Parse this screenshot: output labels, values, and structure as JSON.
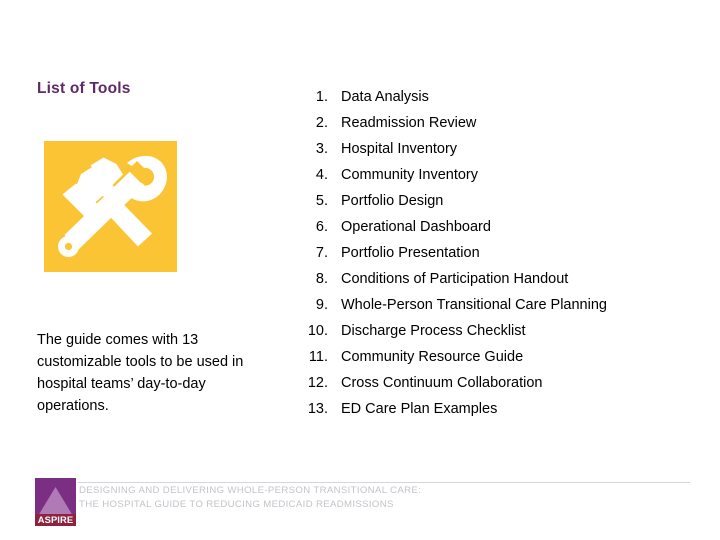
{
  "slide": {
    "title": "List of Tools",
    "background_color": "#ffffff",
    "title_color": "#5e2a68",
    "icon": {
      "name": "hammer-wrench-tools-icon",
      "background_color": "#fbc435",
      "glyph_color": "#ffffff"
    },
    "description": "The guide comes with 13 customizable tools to be used in hospital teams’ day-to-day operations.",
    "tools": [
      {
        "number": "1.",
        "label": "Data Analysis"
      },
      {
        "number": "2.",
        "label": "Readmission Review"
      },
      {
        "number": "3.",
        "label": "Hospital Inventory"
      },
      {
        "number": "4.",
        "label": "Community Inventory"
      },
      {
        "number": "5.",
        "label": "Portfolio Design"
      },
      {
        "number": "6.",
        "label": "Operational Dashboard"
      },
      {
        "number": "7.",
        "label": "Portfolio Presentation"
      },
      {
        "number": "8.",
        "label": "Conditions of Participation Handout"
      },
      {
        "number": "9.",
        "label": "Whole-Person Transitional Care Planning"
      },
      {
        "number": "10.",
        "label": "Discharge Process Checklist"
      },
      {
        "number": "11.",
        "label": "Community Resource Guide"
      },
      {
        "number": "12.",
        "label": "Cross Continuum Collaboration"
      },
      {
        "number": "13.",
        "label": "ED Care Plan Examples"
      }
    ]
  },
  "footer": {
    "logo": {
      "name": "aspire-logo",
      "wordmark": "ASPIRE",
      "square_color": "#7b2f82",
      "triangle_color": "#b07ab6",
      "band_color": "#8e2340"
    },
    "line1": "Designing and Delivering Whole-Person Transitional Care:",
    "line2": "The Hospital Guide to Reducing Medicaid Readmissions",
    "text_color": "#c3c3ca"
  }
}
